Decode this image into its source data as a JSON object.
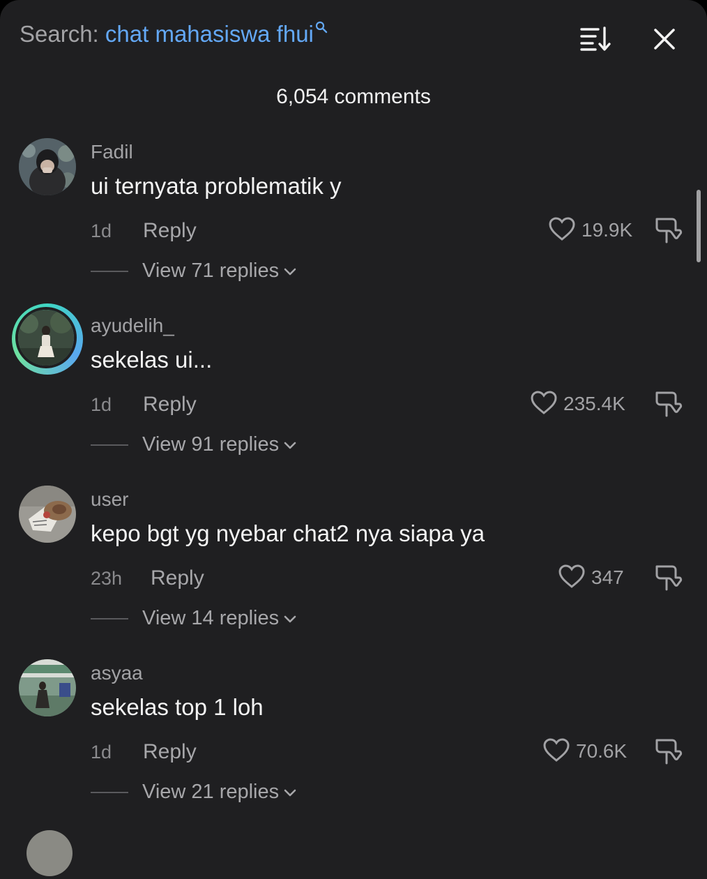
{
  "header": {
    "search_label": "Search: ",
    "search_query": "chat mahasiswa fhui",
    "search_icon": "search-icon",
    "sort_icon": "sort-icon",
    "close_icon": "close-icon"
  },
  "comment_count": "6,054 comments",
  "comments": [
    {
      "username": "Fadil",
      "text": "ui ternyata problematik y",
      "time": "1d",
      "reply_label": "Reply",
      "likes": "19.9K",
      "view_replies": "View 71 replies"
    },
    {
      "username": "ayudelih_",
      "text": "sekelas ui...",
      "time": "1d",
      "reply_label": "Reply",
      "likes": "235.4K",
      "view_replies": "View 91 replies"
    },
    {
      "username": "user",
      "text": "kepo bgt yg nyebar chat2 nya siapa ya",
      "time": "23h",
      "reply_label": "Reply",
      "likes": "347",
      "view_replies": "View 14 replies"
    },
    {
      "username": "asyaa",
      "text": "sekelas top 1 loh",
      "time": "1d",
      "reply_label": "Reply",
      "likes": "70.6K",
      "view_replies": "View 21 replies"
    }
  ],
  "colors": {
    "background": "#1f1f21",
    "query": "#63a8f6",
    "muted": "#a2a2a5",
    "text": "#f4f4f4",
    "story_ring": "#3fd6c4"
  }
}
